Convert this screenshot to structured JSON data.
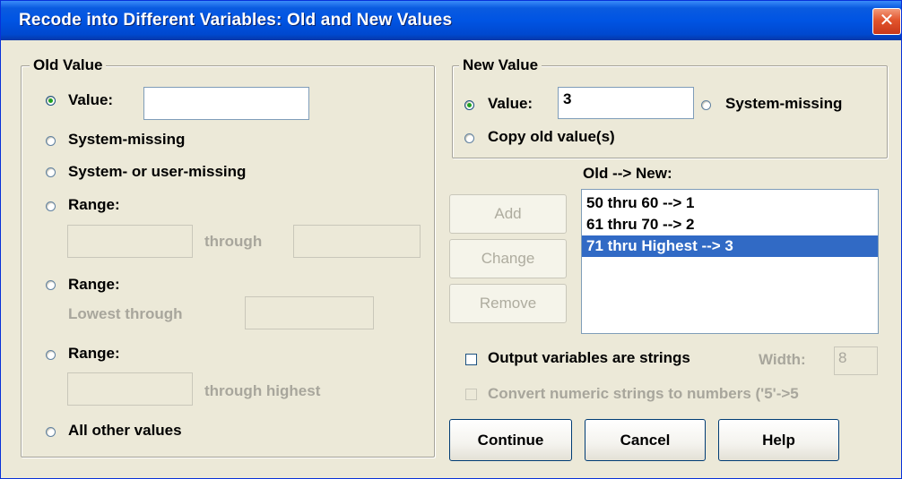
{
  "window": {
    "title": "Recode into Different Variables: Old and New Values",
    "close_glyph": "✕"
  },
  "old_value": {
    "group_title": "Old Value",
    "value_label": "Value:",
    "value_input": "",
    "value_selected": true,
    "system_missing_label": "System-missing",
    "sys_user_missing_label": "System- or user-missing",
    "range1_label": "Range:",
    "range1_through": "through",
    "range2_label": "Range:",
    "range2_lowest_through": "Lowest through",
    "range3_label": "Range:",
    "range3_through_highest": "through highest",
    "all_other_label": "All other values"
  },
  "new_value": {
    "group_title": "New Value",
    "value_label": "Value:",
    "value_input": "3",
    "value_selected": true,
    "system_missing_label": "System-missing",
    "copy_old_label": "Copy old value(s)"
  },
  "mapping": {
    "header": "Old --> New:",
    "items": [
      {
        "text": "50 thru 60 --> 1",
        "selected": false
      },
      {
        "text": "61 thru 70 --> 2",
        "selected": false
      },
      {
        "text": "71 thru Highest --> 3",
        "selected": true
      }
    ],
    "add_label": "Add",
    "change_label": "Change",
    "remove_label": "Remove"
  },
  "options": {
    "output_strings_label": "Output variables are strings",
    "output_strings_checked": false,
    "width_label": "Width:",
    "width_value": "8",
    "convert_label": "Convert numeric strings to numbers ('5'->5",
    "convert_checked": false
  },
  "buttons": {
    "continue": "Continue",
    "cancel": "Cancel",
    "help": "Help"
  },
  "colors": {
    "titlebar": "#0054e3",
    "selection": "#316ac5",
    "dialog_bg": "#ece9d8"
  }
}
